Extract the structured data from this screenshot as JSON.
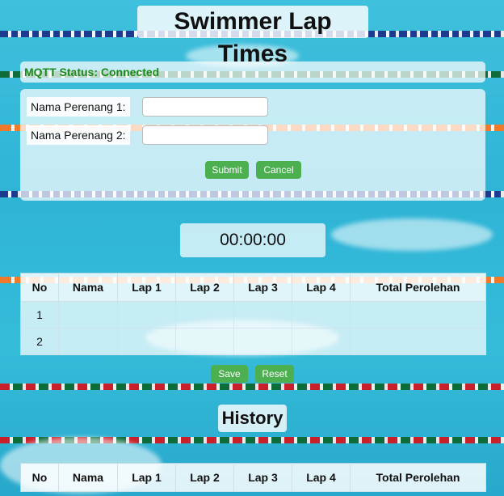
{
  "page": {
    "title": "Swimmer Lap Times",
    "mqtt_status": "MQTT Status: Connected"
  },
  "form": {
    "swimmer1_label": "Nama Perenang 1:",
    "swimmer1_value": "",
    "swimmer2_label": "Nama Perenang 2:",
    "swimmer2_value": "",
    "submit_label": "Submit",
    "cancel_label": "Cancel"
  },
  "timer": {
    "value": "00:00:00"
  },
  "lap_table": {
    "headers": [
      "No",
      "Nama",
      "Lap 1",
      "Lap 2",
      "Lap 3",
      "Lap 4",
      "Total Perolehan"
    ],
    "rows": [
      [
        "1",
        "",
        "",
        "",
        "",
        "",
        ""
      ],
      [
        "2",
        "",
        "",
        "",
        "",
        "",
        ""
      ]
    ]
  },
  "actions": {
    "save_label": "Save",
    "reset_label": "Reset"
  },
  "history": {
    "title": "History",
    "headers": [
      "No",
      "Nama",
      "Lap 1",
      "Lap 2",
      "Lap 3",
      "Lap 4",
      "Total Perolehan"
    ]
  },
  "colors": {
    "button_green": "#4caf50",
    "status_green": "#1b8a1b",
    "pool_blue": "#35bcd9"
  }
}
